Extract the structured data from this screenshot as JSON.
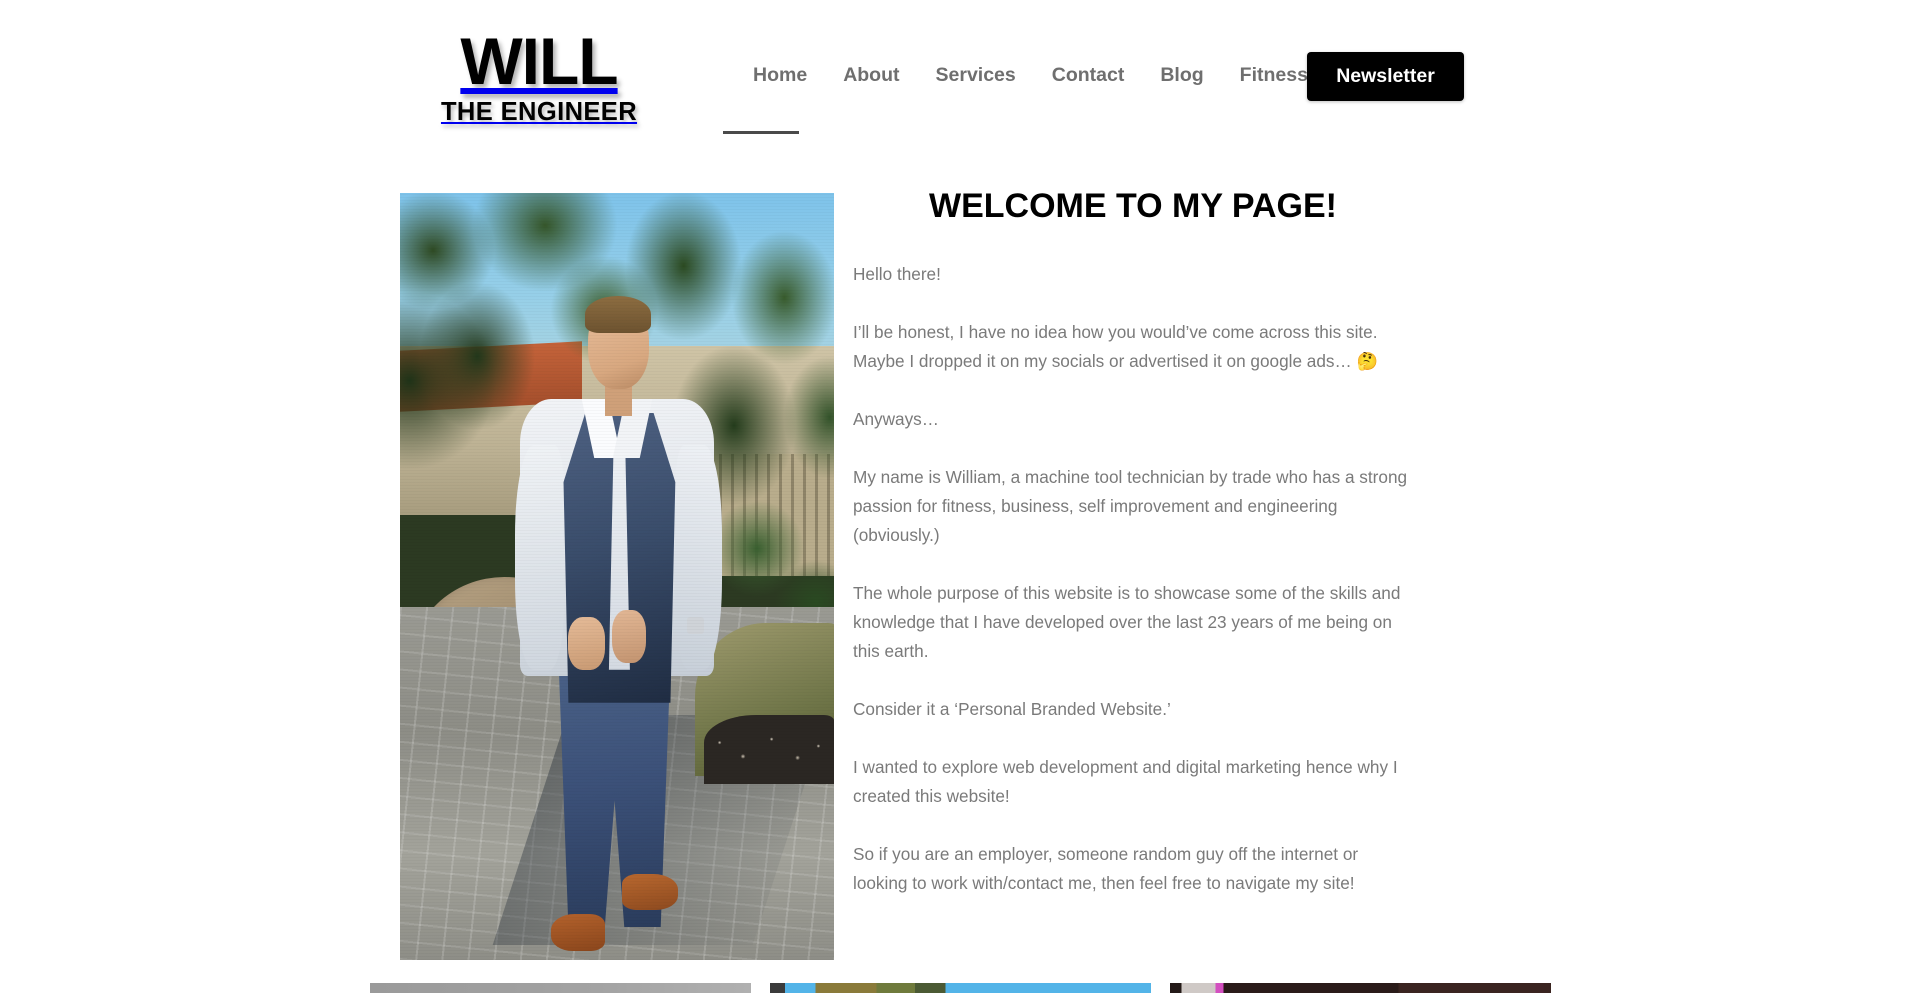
{
  "header": {
    "logo": {
      "main": "WILL",
      "sub": "THE ENGINEER"
    },
    "nav": [
      {
        "label": "Home",
        "active": true
      },
      {
        "label": "About",
        "active": false
      },
      {
        "label": "Services",
        "active": false
      },
      {
        "label": "Contact",
        "active": false
      },
      {
        "label": "Blog",
        "active": false
      },
      {
        "label": "Fitness",
        "active": false
      }
    ],
    "newsletter_label": "Newsletter",
    "colors": {
      "nav_text": "#6f6f6f",
      "nav_active_underline": "#4a4a4a",
      "button_bg": "#000000",
      "button_text": "#ffffff"
    }
  },
  "main": {
    "title": "WELCOME TO MY PAGE!",
    "photo_alt": "Man in blue waistcoat and trousers standing on a paved garden path",
    "paragraphs": [
      "Hello there!",
      "I’ll be honest, I have no idea how you would’ve come across this site. Maybe I dropped it on my socials or advertised it on google ads… 🤔",
      "Anyways…",
      "My name is William, a machine tool technician by trade who has a strong passion for fitness, business, self improvement and engineering (obviously.)",
      "The whole purpose of this website is to showcase some of the skills and knowledge that I have developed over the last 23 years of me being on this earth.",
      "Consider it a ‘Personal Branded Website.’",
      "I wanted to explore web development and digital marketing hence why I created this website!",
      "So if you are an employer, someone random guy off the internet or looking to work with/contact me, then feel free to navigate my site!"
    ],
    "body_text_color": "#7a7a7a"
  },
  "cards": [
    {
      "name": "card-grey",
      "style": "card-grey"
    },
    {
      "name": "card-field",
      "style": "card-field"
    },
    {
      "name": "card-dark",
      "style": "card-dark"
    }
  ]
}
